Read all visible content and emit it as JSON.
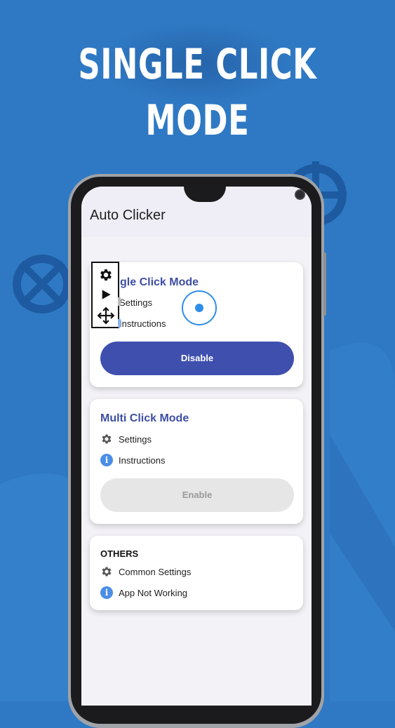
{
  "promo": {
    "headline": "SINGLE CLICK MODE"
  },
  "app": {
    "title": "Auto Clicker"
  },
  "cards": {
    "single": {
      "title_partial": "gle Click Mode",
      "settings_label": "Settings",
      "instructions_label": "Instructions",
      "button_label": "Disable"
    },
    "multi": {
      "title": "Multi Click Mode",
      "settings_label": "Settings",
      "instructions_label": "Instructions",
      "button_label": "Enable"
    },
    "others": {
      "title": "OTHERS",
      "common_settings_label": "Common Settings",
      "app_not_working_label": "App Not Working"
    }
  },
  "overlay": {
    "icons": [
      "gear-icon",
      "play-icon",
      "move-icon"
    ]
  },
  "icons": {
    "info_glyph": "i"
  },
  "colors": {
    "background": "#2f79c4",
    "accent": "#3f4fae",
    "title_blue": "#3d4ea3",
    "target_blue": "#2e8de6",
    "info_blue": "#4b8ee6"
  }
}
